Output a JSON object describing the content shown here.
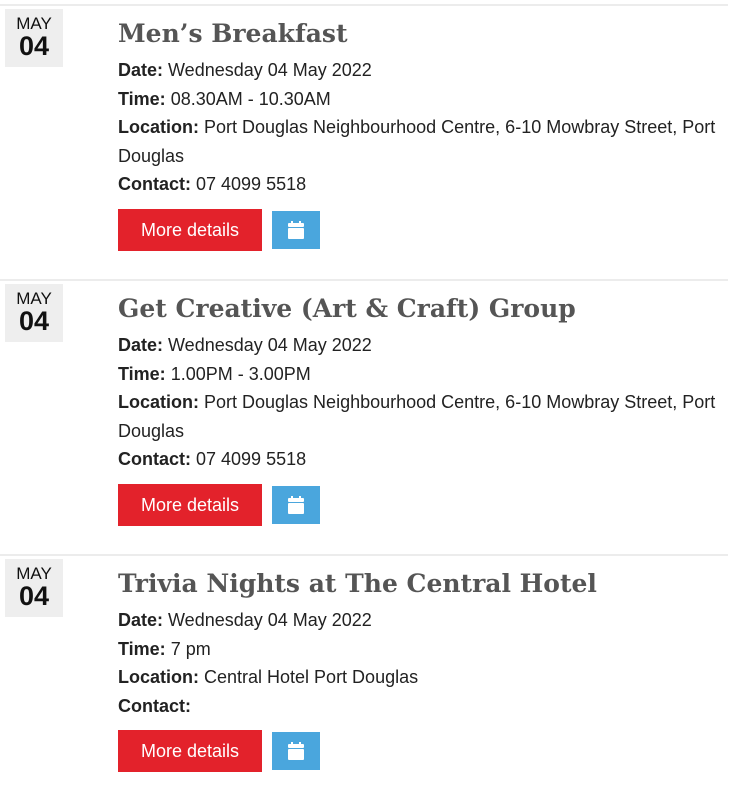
{
  "events": [
    {
      "month": "MAY",
      "day": "04",
      "title": "Men’s Breakfast",
      "date_label": "Date:",
      "date": " Wednesday 04 May 2022",
      "time_label": "Time:",
      "time": " 08.30AM - 10.30AM",
      "location_label": "Location:",
      "location": " Port Douglas Neighbourhood Centre, 6-10 Mowbray Street, Port Douglas",
      "contact_label": "Contact:",
      "contact": " 07 4099 5518",
      "more_label": "More details",
      "calendar_icon": "calendar-icon"
    },
    {
      "month": "MAY",
      "day": "04",
      "title": "Get Creative (Art & Craft) Group",
      "date_label": "Date:",
      "date": " Wednesday 04 May 2022",
      "time_label": "Time:",
      "time": " 1.00PM - 3.00PM",
      "location_label": "Location:",
      "location": " Port Douglas Neighbourhood Centre, 6-10 Mowbray Street, Port Douglas",
      "contact_label": "Contact:",
      "contact": " 07 4099 5518",
      "more_label": "More details",
      "calendar_icon": "calendar-icon"
    },
    {
      "month": "MAY",
      "day": "04",
      "title": "Trivia Nights at The Central Hotel",
      "date_label": "Date:",
      "date": " Wednesday 04 May 2022",
      "time_label": "Time:",
      "time": " 7 pm",
      "location_label": "Location:",
      "location": " Central Hotel Port Douglas",
      "contact_label": "Contact:",
      "contact": "",
      "more_label": "More details",
      "calendar_icon": "calendar-icon"
    }
  ],
  "colors": {
    "more_button": "#e3222b",
    "calendar_button": "#4aa6dd",
    "title": "#555555",
    "date_badge_bg": "#eeeeee"
  }
}
